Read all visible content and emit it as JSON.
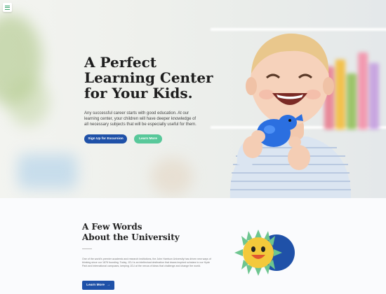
{
  "hero": {
    "title_line1": "A Perfect",
    "title_line2": "Learning Center",
    "title_line3": "for Your Kids.",
    "text": "Any successful career starts with good education. At our learning center, your children will have deeper knowledge of all necessary subjects that will be especially useful for them.",
    "signup_label": "Sign Up for Excursion",
    "learn_label": "Learn More"
  },
  "about": {
    "title_line1": "A Few Words",
    "title_line2": "About the University",
    "text": "One of the world's premier academic and research institutions, the John Harrison University has driven new ways of thinking since our 1876 founding. Today, JCU is an intellectual destination that draws inspired scholars to our Hyde Park and international campuses, keeping JCU at the nexus of ideas that challenge and change the world.",
    "learn_label": "Learn More",
    "arrow": "→"
  },
  "colors": {
    "primary": "#1f51a8",
    "accent": "#58c89a",
    "menu_icon": "#3aa46b",
    "sun": "#f3c93b",
    "sun_rays": "#6dc58f"
  }
}
